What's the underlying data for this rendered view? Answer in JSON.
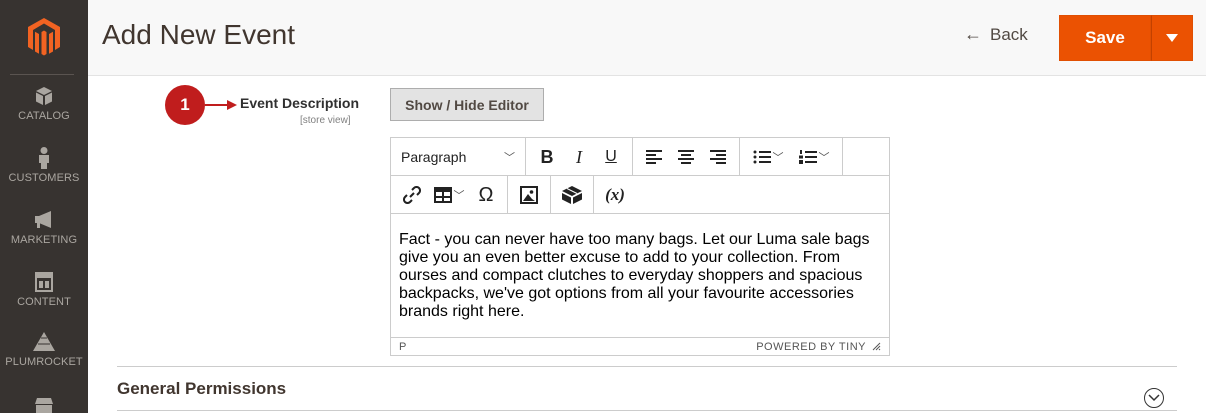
{
  "header": {
    "title": "Add New Event",
    "back_label": "Back",
    "save_label": "Save"
  },
  "sidebar": {
    "items": [
      {
        "label": "CATALOG",
        "icon": "cube-icon"
      },
      {
        "label": "CUSTOMERS",
        "icon": "person-icon"
      },
      {
        "label": "MARKETING",
        "icon": "megaphone-icon"
      },
      {
        "label": "CONTENT",
        "icon": "layout-icon"
      },
      {
        "label": "PLUMROCKET",
        "icon": "pyramid-icon"
      }
    ]
  },
  "callout": {
    "number": "1"
  },
  "field": {
    "label": "Event Description",
    "scope": "[store view]"
  },
  "toggle_button": "Show / Hide Editor",
  "editor": {
    "format_value": "Paragraph",
    "content": "Fact - you can never have too many bags. Let our Luma sale bags give you an even better excuse to add to your collection. From ourses and compact clutches to everyday shoppers and spacious backpacks, we've got options from all your favourite accessories brands right here.",
    "path": "P",
    "powered_by": "POWERED BY TINY"
  },
  "section": {
    "title": "General Permissions"
  },
  "colors": {
    "accent": "#eb5202",
    "sidebar": "#373330",
    "badge": "#c01d1d"
  }
}
